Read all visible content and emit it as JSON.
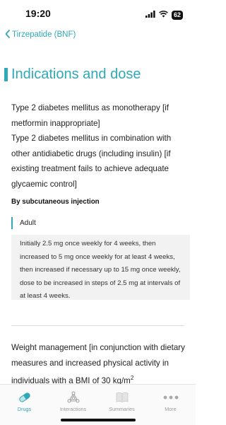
{
  "status_bar": {
    "time": "19:20",
    "battery": "62",
    "icons": [
      "cellular-icon",
      "wifi-icon",
      "battery-icon"
    ]
  },
  "nav": {
    "back_label": "Tirzepatide (BNF)"
  },
  "section": {
    "title": "Indications and dose"
  },
  "indication_1": {
    "line_1": "Type 2 diabetes mellitus as monotherapy [if metformin inappropriate]",
    "line_2": "Type 2 diabetes mellitus in combination with other antidiabetic drugs (including insulin) [if existing treatment fails to achieve adequate glycaemic control]"
  },
  "route": "By subcutaneous injection",
  "population": "Adult",
  "dose_text": "Initially 2.5 mg once weekly for 4 weeks, then increased to 5 mg once weekly for at least 4 weeks, then increased if necessary up to 15 mg once weekly, dose to be increased in steps of 2.5 mg at intervals of at least 4 weeks.",
  "indication_2": {
    "text": "Weight management [in conjunction with dietary measures and increased physical activity in individuals with a BMI of 30 kg/m",
    "superscript": "2"
  },
  "tabs": [
    {
      "label": "Drugs",
      "icon": "pill-icon",
      "active": true
    },
    {
      "label": "Interactions",
      "icon": "network-icon",
      "active": false
    },
    {
      "label": "Summaries",
      "icon": "book-icon",
      "active": false
    },
    {
      "label": "More",
      "icon": "more-dots-icon",
      "active": false
    }
  ],
  "colors": {
    "accent": "#2fa9b7",
    "inactive_tab": "#9a9a9a",
    "dose_box_bg": "#f2f2f2"
  }
}
